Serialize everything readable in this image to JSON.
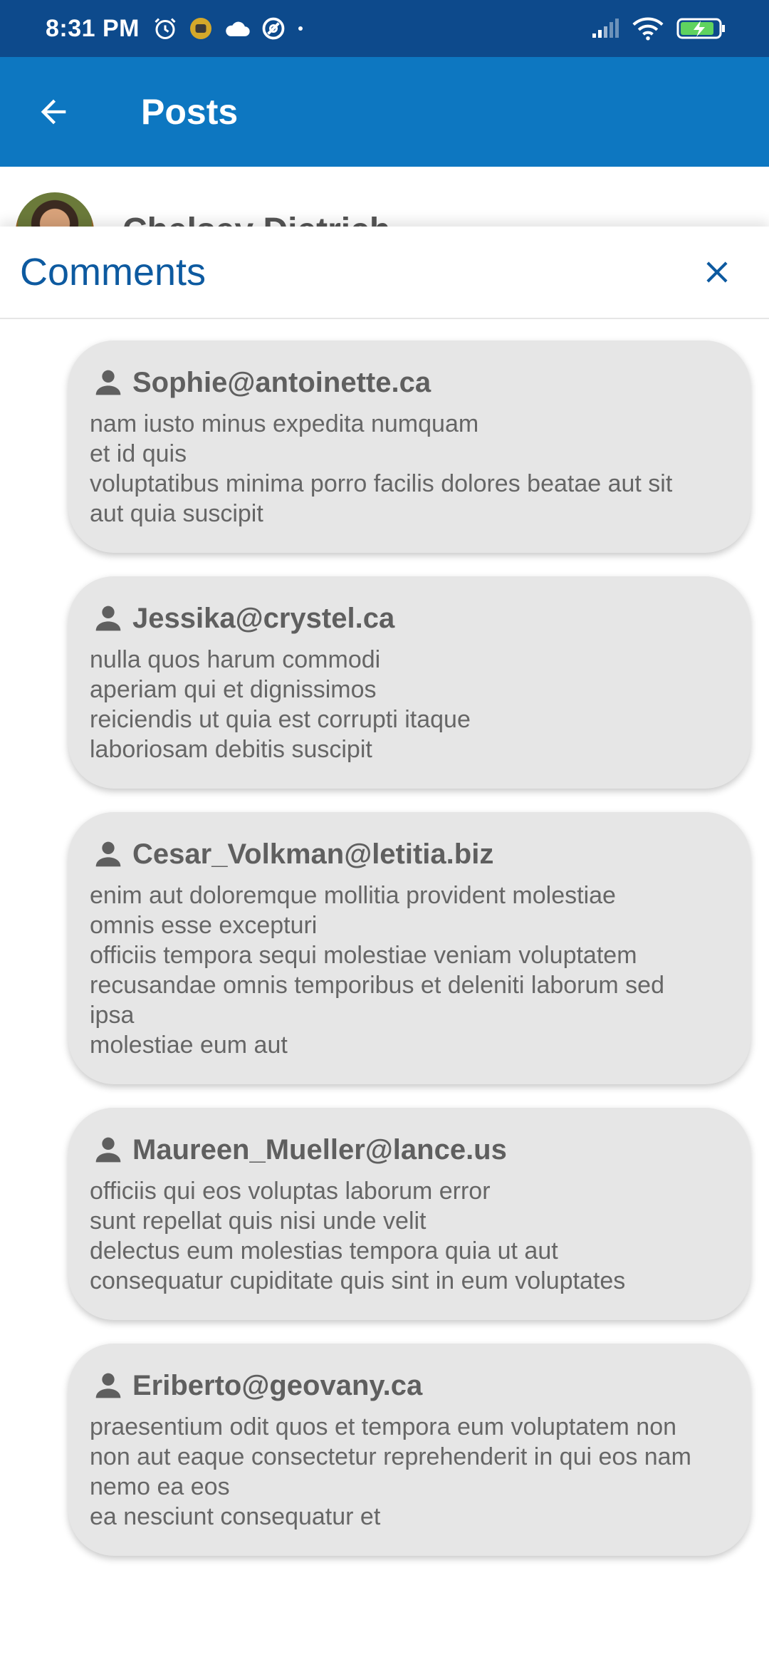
{
  "status_bar": {
    "time": "8:31 PM",
    "icons_left": [
      "alarm-icon",
      "badge-icon",
      "cloud-icon",
      "at-sign-icon",
      "dot-icon"
    ],
    "icons_right": [
      "signal-icon",
      "wifi-icon",
      "battery-charging-icon"
    ]
  },
  "app_bar": {
    "title": "Posts",
    "back_icon": "arrow-back-icon"
  },
  "post": {
    "author": "Chelsey Dietrich"
  },
  "comments_sheet": {
    "title": "Comments",
    "close_icon": "close-icon",
    "comments": [
      {
        "author": "Sophie@antoinette.ca",
        "body": "nam iusto minus expedita numquam\net id quis\nvoluptatibus minima porro facilis dolores beatae aut sit\naut quia suscipit"
      },
      {
        "author": "Jessika@crystel.ca",
        "body": "nulla quos harum commodi\naperiam qui et dignissimos\nreiciendis ut quia est corrupti itaque\nlaboriosam debitis suscipit"
      },
      {
        "author": "Cesar_Volkman@letitia.biz",
        "body": "enim aut doloremque mollitia provident molestiae\nomnis esse excepturi\nofficiis tempora sequi molestiae veniam voluptatem\nrecusandae omnis temporibus et deleniti laborum sed\nipsa\nmolestiae eum aut"
      },
      {
        "author": "Maureen_Mueller@lance.us",
        "body": "officiis qui eos voluptas laborum error\nsunt repellat quis nisi unde velit\ndelectus eum molestias tempora quia ut aut\nconsequatur cupiditate quis sint in eum voluptates"
      },
      {
        "author": "Eriberto@geovany.ca",
        "body": "praesentium odit quos et tempora eum voluptatem non\nnon aut eaque consectetur reprehenderit in qui eos nam\nnemo ea eos\nea nesciunt consequatur et"
      }
    ]
  },
  "colors": {
    "status_bar": "#0d4a8c",
    "app_bar": "#0d77c1",
    "accent": "#0d5aa0",
    "comment_bg": "#e6e6e6"
  }
}
